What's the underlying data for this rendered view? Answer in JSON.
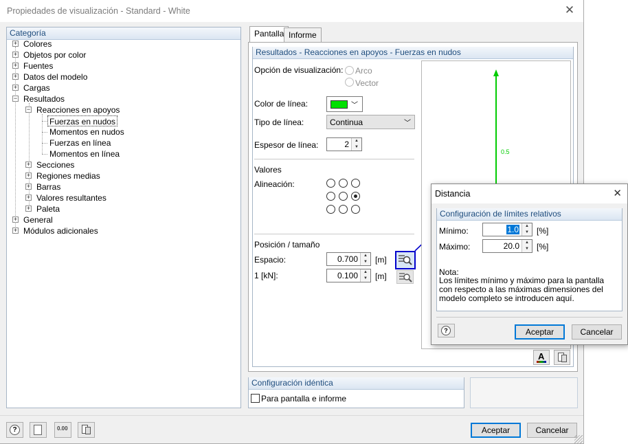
{
  "window": {
    "title": "Propiedades de visualización - Standard - White",
    "close_glyph": "✕"
  },
  "categoria": {
    "header": "Categoría",
    "items": [
      {
        "label": "Colores"
      },
      {
        "label": "Objetos por color"
      },
      {
        "label": "Fuentes"
      },
      {
        "label": "Datos del modelo"
      },
      {
        "label": "Cargas"
      },
      {
        "label": "Resultados"
      },
      {
        "label": "Reacciones en apoyos"
      },
      {
        "label": "Fuerzas en nudos"
      },
      {
        "label": "Momentos en nudos"
      },
      {
        "label": "Fuerzas en línea"
      },
      {
        "label": "Momentos en línea"
      },
      {
        "label": "Secciones"
      },
      {
        "label": "Regiones medias"
      },
      {
        "label": "Barras"
      },
      {
        "label": "Valores resultantes"
      },
      {
        "label": "Paleta"
      },
      {
        "label": "General"
      },
      {
        "label": "Módulos adicionales"
      }
    ]
  },
  "tabs": [
    {
      "label": "Pantalla"
    },
    {
      "label": "Informe"
    }
  ],
  "results": {
    "header": "Resultados - Reacciones en apoyos - Fuerzas en nudos",
    "opcion_label": "Opción de visualización:",
    "radio_arco": "Arco",
    "radio_vector": "Vector",
    "color_label": "Color de línea:",
    "line_color": "#00e000",
    "tipo_label": "Tipo de línea:",
    "tipo_value": "Continua",
    "espesor_label": "Espesor de línea:",
    "espesor_value": "2",
    "valores_label": "Valores",
    "alineacion_label": "Alineación:",
    "posicion_label": "Posición / tamaño",
    "espacio_label": "Espacio:",
    "espacio_value": "0.700",
    "espacio_unit": "[m]",
    "scale_label": "1 [kN]:",
    "scale_value": "0.100",
    "scale_unit": "[m]",
    "preview_value": "0.5",
    "arrow_color": "#00cc00"
  },
  "identica": {
    "header": "Configuración idéntica",
    "checkbox_label": "Para pantalla e informe"
  },
  "footer": {
    "ok": "Aceptar",
    "cancel": "Cancelar"
  },
  "dialog": {
    "title": "Distancia",
    "header": "Configuración de límites relativos",
    "minimo_label": "Mínimo:",
    "minimo_value": "1.0",
    "maximo_label": "Máximo:",
    "maximo_value": "20.0",
    "unit": "[%]",
    "nota_title": "Nota:",
    "nota_text": "Los límites mínimo y máximo para la pantalla con respecto a las máximas dimensiones del modelo completo se introducen aquí.",
    "ok": "Aceptar",
    "cancel": "Cancelar"
  },
  "colors": {
    "accent_blue": "#0000cc",
    "header_text": "#1e4c7d"
  }
}
